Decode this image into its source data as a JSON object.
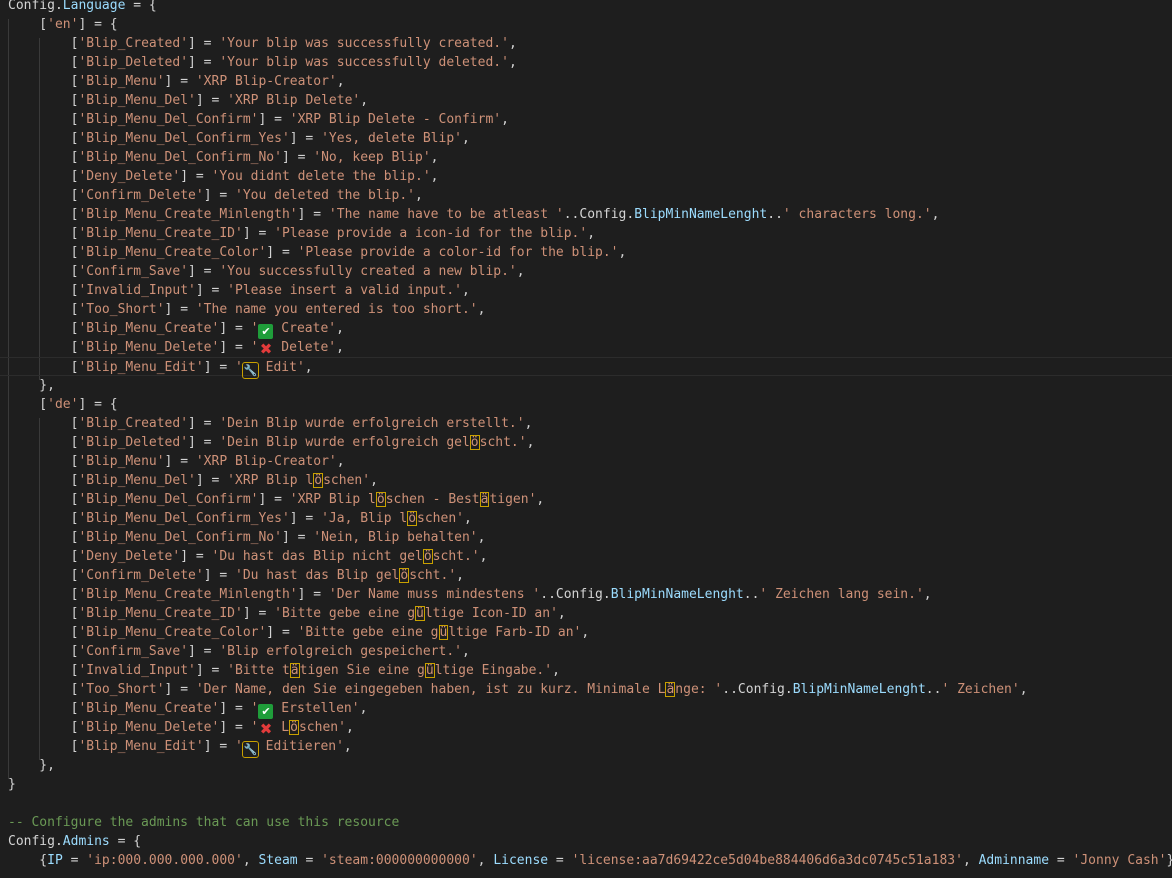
{
  "editor": {
    "lines": [
      {
        "k": "code",
        "text": "Config.Language = {"
      },
      {
        "k": "code",
        "text": "    ['en'] = {"
      },
      {
        "k": "entry",
        "key": "Blip_Created",
        "val": "'Your blip was successfully created.',"
      },
      {
        "k": "entry",
        "key": "Blip_Deleted",
        "val": "'Your blip was successfully deleted.',"
      },
      {
        "k": "entry",
        "key": "Blip_Menu",
        "val": "'XRP Blip-Creator',"
      },
      {
        "k": "entry",
        "key": "Blip_Menu_Del",
        "val": "'XRP Blip Delete',"
      },
      {
        "k": "entry",
        "key": "Blip_Menu_Del_Confirm",
        "val": "'XRP Blip Delete - Confirm',"
      },
      {
        "k": "entry",
        "key": "Blip_Menu_Del_Confirm_Yes",
        "val": "'Yes, delete Blip',"
      },
      {
        "k": "entry",
        "key": "Blip_Menu_Del_Confirm_No",
        "val": "'No, keep Blip',"
      },
      {
        "k": "entry",
        "key": "Deny_Delete",
        "val": "'You didnt delete the blip.',"
      },
      {
        "k": "entry",
        "key": "Confirm_Delete",
        "val": "'You deleted the blip.',"
      },
      {
        "k": "entry",
        "key": "Blip_Menu_Create_Minlength",
        "val": "'The name have to be atleast '..Config.BlipMinNameLenght..' characters long.',"
      },
      {
        "k": "entry",
        "key": "Blip_Menu_Create_ID",
        "val": "'Please provide a icon-id for the blip.',"
      },
      {
        "k": "entry",
        "key": "Blip_Menu_Create_Color",
        "val": "'Please provide a color-id for the blip.',"
      },
      {
        "k": "entry",
        "key": "Confirm_Save",
        "val": "'You successfully created a new blip.',"
      },
      {
        "k": "entry",
        "key": "Invalid_Input",
        "val": "'Please insert a valid input.',"
      },
      {
        "k": "entry",
        "key": "Too_Short",
        "val": "'The name you entered is too short.',"
      },
      {
        "k": "entry",
        "key": "Blip_Menu_Create",
        "icon": "check",
        "val": " Create',"
      },
      {
        "k": "entry",
        "key": "Blip_Menu_Delete",
        "icon": "cross",
        "val": " Delete',"
      },
      {
        "k": "entry",
        "key": "Blip_Menu_Edit",
        "icon": "wrench",
        "val": " Edit',"
      },
      {
        "k": "code",
        "text": "    },"
      },
      {
        "k": "code",
        "text": "    ['de'] = {"
      },
      {
        "k": "entry",
        "key": "Blip_Created",
        "val": "'Dein Blip wurde erfolgreich erstellt.',"
      },
      {
        "k": "entry",
        "key": "Blip_Deleted",
        "val": "'Dein Blip wurde erfolgreich gelöscht.',"
      },
      {
        "k": "entry",
        "key": "Blip_Menu",
        "val": "'XRP Blip-Creator',"
      },
      {
        "k": "entry",
        "key": "Blip_Menu_Del",
        "val": "'XRP Blip löschen',"
      },
      {
        "k": "entry",
        "key": "Blip_Menu_Del_Confirm",
        "val": "'XRP Blip löschen - Bestätigen',"
      },
      {
        "k": "entry",
        "key": "Blip_Menu_Del_Confirm_Yes",
        "val": "'Ja, Blip löschen',"
      },
      {
        "k": "entry",
        "key": "Blip_Menu_Del_Confirm_No",
        "val": "'Nein, Blip behalten',"
      },
      {
        "k": "entry",
        "key": "Deny_Delete",
        "val": "'Du hast das Blip nicht gelöscht.',"
      },
      {
        "k": "entry",
        "key": "Confirm_Delete",
        "val": "'Du hast das Blip gelöscht.',"
      },
      {
        "k": "entry",
        "key": "Blip_Menu_Create_Minlength",
        "val": "'Der Name muss mindestens '..Config.BlipMinNameLenght..' Zeichen lang sein.',"
      },
      {
        "k": "entry",
        "key": "Blip_Menu_Create_ID",
        "val": "'Bitte gebe eine gültige Icon-ID an',"
      },
      {
        "k": "entry",
        "key": "Blip_Menu_Create_Color",
        "val": "'Bitte gebe eine gültige Farb-ID an',"
      },
      {
        "k": "entry",
        "key": "Confirm_Save",
        "val": "'Blip erfolgreich gespeichert.',"
      },
      {
        "k": "entry",
        "key": "Invalid_Input",
        "val": "'Bitte tätigen Sie eine gültige Eingabe.',"
      },
      {
        "k": "entry",
        "key": "Too_Short",
        "val": "'Der Name, den Sie eingegeben haben, ist zu kurz. Minimale Länge: '..Config.BlipMinNameLenght..' Zeichen',"
      },
      {
        "k": "entry",
        "key": "Blip_Menu_Create",
        "icon": "check",
        "val": " Erstellen',"
      },
      {
        "k": "entry",
        "key": "Blip_Menu_Delete",
        "icon": "cross",
        "val": " Löschen',"
      },
      {
        "k": "entry",
        "key": "Blip_Menu_Edit",
        "icon": "wrench",
        "val": " Editieren',"
      },
      {
        "k": "code",
        "text": "    },"
      },
      {
        "k": "code",
        "text": "}"
      },
      {
        "k": "code",
        "text": ""
      },
      {
        "k": "comment",
        "text": "-- Configure the admins that can use this resource"
      },
      {
        "k": "code",
        "text": "Config.Admins = {"
      },
      {
        "k": "code",
        "text": "    {IP = 'ip:000.000.000.000', Steam = 'steam:000000000000', License = 'license:aa7d69422ce5d04be884406d6a3dc0745c51a183', Adminname = 'Jonny Cash'},"
      }
    ]
  }
}
